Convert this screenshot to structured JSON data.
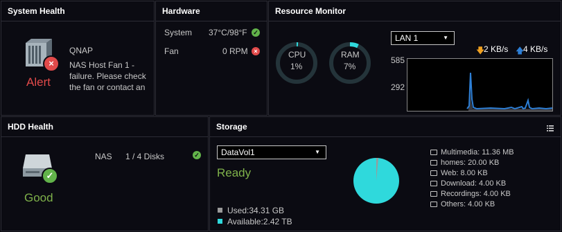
{
  "system_health": {
    "title": "System Health",
    "device_name": "QNAP",
    "message_lines": [
      "NAS Host Fan 1 -",
      "failure. Please check",
      "the fan or contact an"
    ],
    "status": "Alert",
    "status_color": "#e14a4a"
  },
  "hardware": {
    "title": "Hardware",
    "items": [
      {
        "label": "System",
        "value": "37°C/98°F",
        "status": "ok"
      },
      {
        "label": "Fan",
        "value": "0 RPM",
        "status": "error"
      }
    ]
  },
  "resource_monitor": {
    "title": "Resource Monitor",
    "cpu": {
      "label": "CPU",
      "value": "1%",
      "percent": 1
    },
    "ram": {
      "label": "RAM",
      "value": "7%",
      "percent": 7
    },
    "interface": "LAN 1",
    "download_rate": "2 KB/s",
    "upload_rate": "4 KB/s",
    "y_ticks": [
      "585",
      "292"
    ],
    "accent_color": "#2d7fd6"
  },
  "hdd_health": {
    "title": "HDD Health",
    "label": "NAS",
    "disks": "1 / 4 Disks",
    "status": "Good",
    "status_color": "#7fb24a"
  },
  "storage": {
    "title": "Storage",
    "volume": "DataVol1",
    "state": "Ready",
    "used": "Used:34.31 GB",
    "available": "Available:2.42 TB",
    "used_fraction": 0.014,
    "used_color": "#9a9a9a",
    "available_color": "#2fd9dc",
    "folders": [
      "Multimedia: 11.36 MB",
      "homes: 20.00 KB",
      "Web: 8.00 KB",
      "Download: 4.00 KB",
      "Recordings: 4.00 KB",
      "Others: 4.00 KB"
    ]
  }
}
